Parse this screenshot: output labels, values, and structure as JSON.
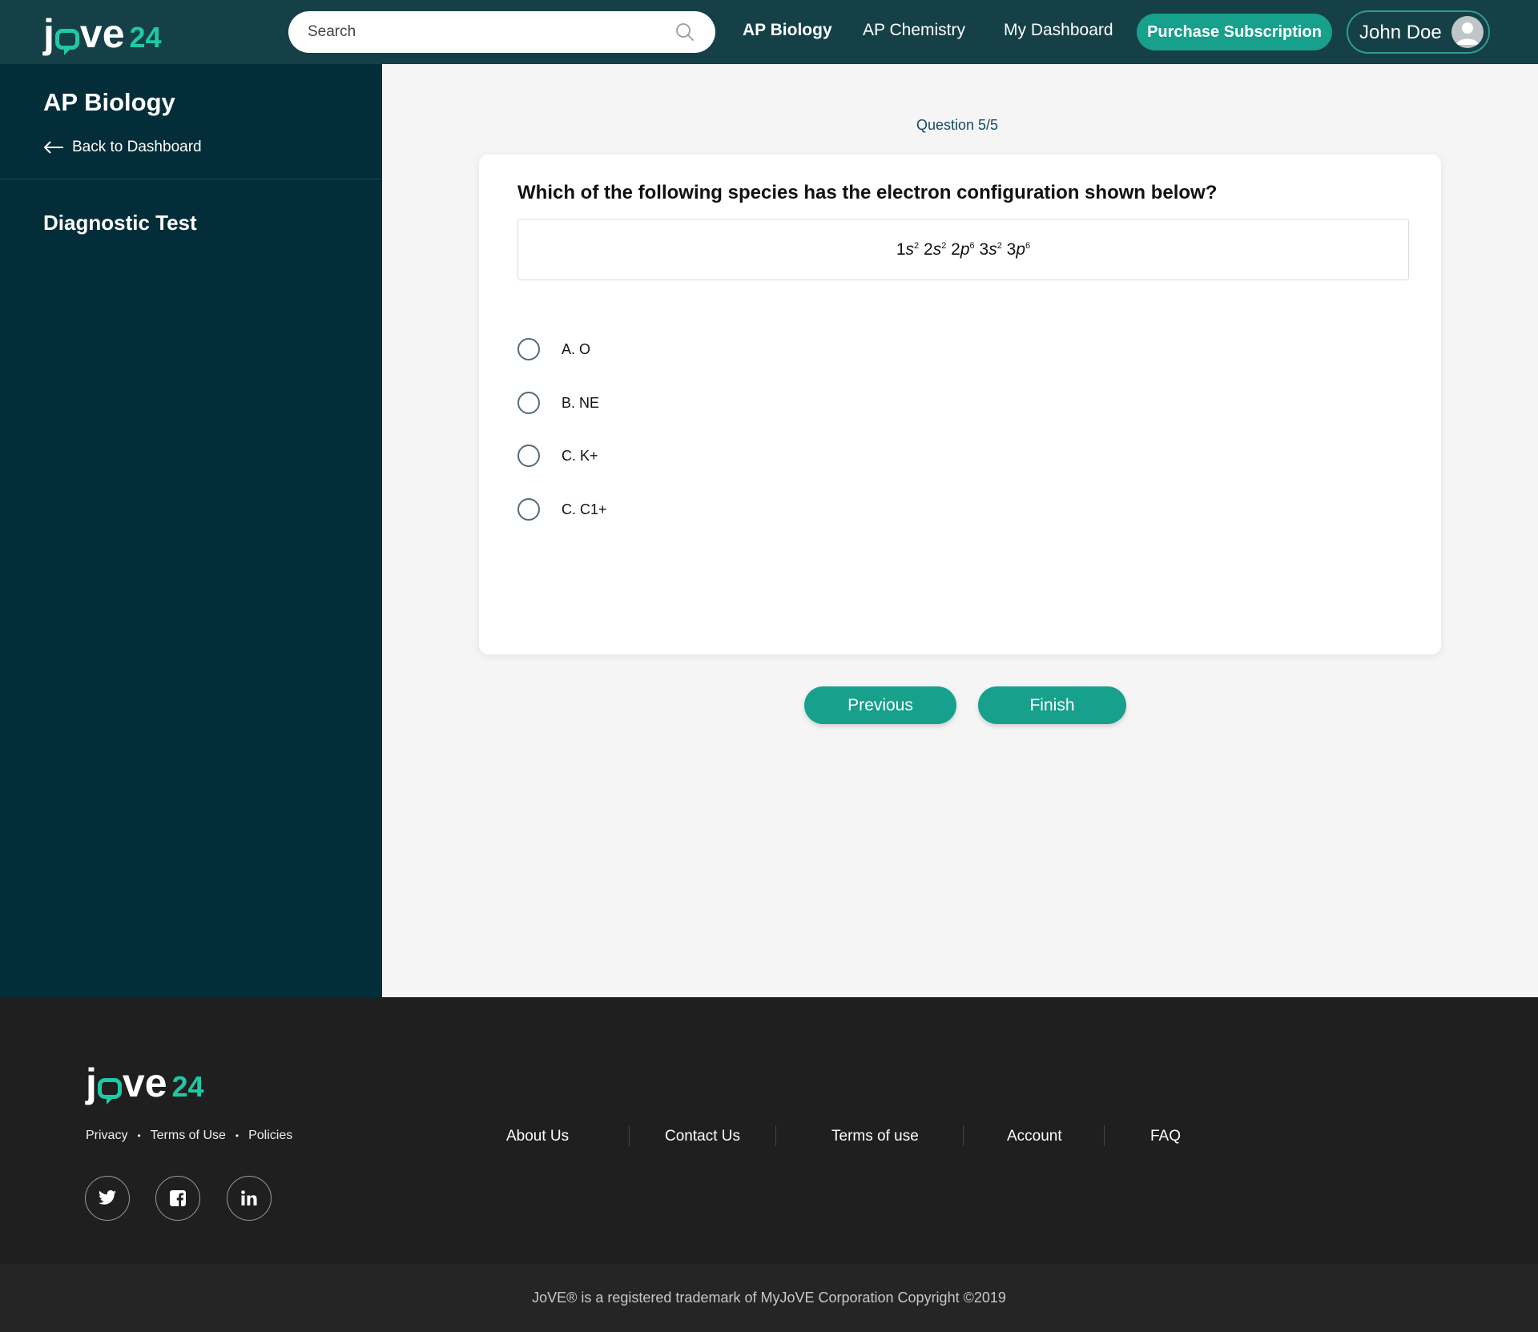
{
  "brand": {
    "logo_j": "j",
    "logo_ve": "ve",
    "logo_num": "24",
    "accent": "#1ec9a3",
    "primary": "#17a08b"
  },
  "header": {
    "search_placeholder": "Search",
    "nav": [
      "AP Biology",
      "AP Chemistry",
      "My Dashboard"
    ],
    "purchase_label": "Purchase Subscription",
    "user_name": "John Doe"
  },
  "sidebar": {
    "title": "AP Biology",
    "back_label": "Back to Dashboard",
    "section": "Diagnostic Test"
  },
  "quiz": {
    "counter": "Question 5/5",
    "question": "Which of the following species has the electron configuration shown below?",
    "formula": "1s2 2s2 2p6 3s2 3p6",
    "options": [
      "A. O",
      "B. NE",
      "C. K+",
      "C. C1+"
    ],
    "prev_label": "Previous",
    "finish_label": "Finish"
  },
  "footer": {
    "legal": [
      "Privacy",
      "Terms of Use",
      "Policies"
    ],
    "links": [
      "About Us",
      "Contact Us",
      "Terms of use",
      "Account",
      "FAQ"
    ],
    "social_icons": [
      "twitter-icon",
      "facebook-icon",
      "linkedin-icon"
    ],
    "copyright": "JoVE® is a registered trademark of MyJoVE Corporation Copyright ©2019"
  }
}
